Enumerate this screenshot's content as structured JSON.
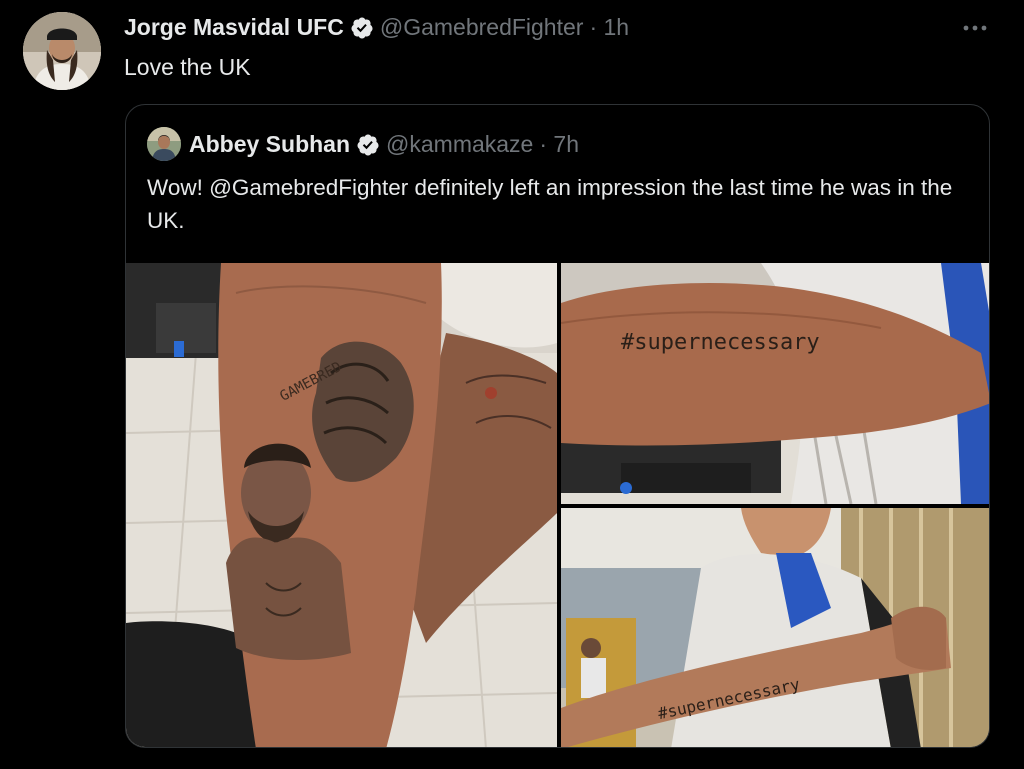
{
  "tweet": {
    "author_name": "Jorge Masvidal UFC",
    "author_handle": "@GamebredFighter",
    "time": "· 1h",
    "text": "Love the UK",
    "avatar_icon": "user-avatar",
    "more_icon": "more-horizontal-icon"
  },
  "quote": {
    "author_name": "Abbey Subhan",
    "author_handle": "@kammakaze",
    "time": "· 7h",
    "text": "Wow! @GamebredFighter definitely left an impression the last time he was in the UK.",
    "images": {
      "left_tattoo_text": "GAMEBRED",
      "forearm_tattoo_text": "#supernecessary"
    }
  },
  "colors": {
    "background": "#000000",
    "text": "#e7e9ea",
    "muted": "#71767b",
    "border": "#2f3336",
    "verified_badge": "#e7e9ea"
  }
}
